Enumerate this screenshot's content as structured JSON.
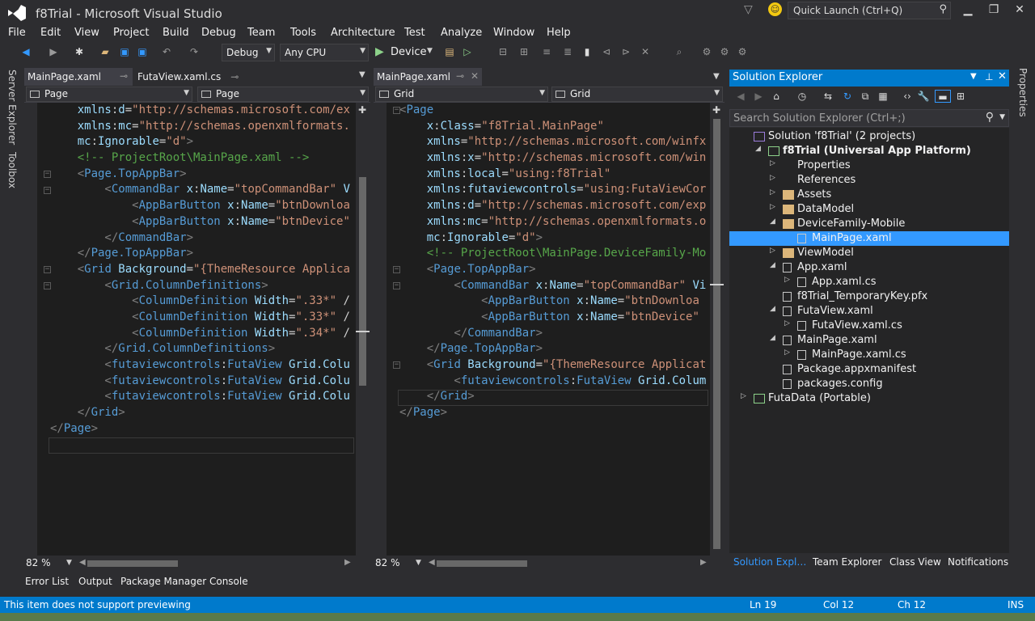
{
  "window": {
    "title": "f8Trial - Microsoft Visual Studio",
    "quick_launch_placeholder": "Quick Launch (Ctrl+Q)"
  },
  "menu": [
    "File",
    "Edit",
    "View",
    "Project",
    "Build",
    "Debug",
    "Team",
    "Tools",
    "Architecture",
    "Test",
    "Analyze",
    "Window",
    "Help"
  ],
  "toolbar": {
    "config": "Debug",
    "platform": "Any CPU",
    "run_target": "Device"
  },
  "side_tabs": [
    "Server Explorer",
    "Toolbox"
  ],
  "right_tabs": [
    "Properties"
  ],
  "left_editor": {
    "tabs": [
      "MainPage.xaml",
      "FutaView.xaml.cs"
    ],
    "nav_left": "Page",
    "nav_right": "Page",
    "zoom": "82 %",
    "lines": [
      [
        [
          "ns",
          "    xmlns"
        ],
        [
          "q",
          ":"
        ],
        [
          "at",
          "d"
        ],
        [
          "q",
          "="
        ],
        [
          "val",
          "\"http://schemas.microsoft.com/ex"
        ]
      ],
      [
        [
          "ns",
          "    xmlns"
        ],
        [
          "q",
          ":"
        ],
        [
          "at",
          "mc"
        ],
        [
          "q",
          "="
        ],
        [
          "val",
          "\"http://schemas.openxmlformats."
        ]
      ],
      [
        [
          "ns",
          "    mc"
        ],
        [
          "q",
          ":"
        ],
        [
          "at",
          "Ignorable"
        ],
        [
          "q",
          "="
        ],
        [
          "val",
          "\"d\""
        ],
        [
          "xb",
          ">"
        ]
      ],
      [
        [
          "cm",
          "    <!-- ProjectRoot\\MainPage.xaml -->"
        ]
      ],
      [
        [
          "xb",
          "    <"
        ],
        [
          "el",
          "Page.TopAppBar"
        ],
        [
          "xb",
          ">"
        ]
      ],
      [
        [
          "xb",
          "        <"
        ],
        [
          "el",
          "CommandBar"
        ],
        [
          "at",
          " x"
        ],
        [
          "q",
          ":"
        ],
        [
          "at",
          "Name"
        ],
        [
          "q",
          "="
        ],
        [
          "val",
          "\"topCommandBar\""
        ],
        [
          "at",
          " V"
        ]
      ],
      [
        [
          "xb",
          "            <"
        ],
        [
          "el",
          "AppBarButton"
        ],
        [
          "at",
          " x"
        ],
        [
          "q",
          ":"
        ],
        [
          "at",
          "Name"
        ],
        [
          "q",
          "="
        ],
        [
          "val",
          "\"btnDownloa"
        ]
      ],
      [
        [
          "xb",
          "            <"
        ],
        [
          "el",
          "AppBarButton"
        ],
        [
          "at",
          " x"
        ],
        [
          "q",
          ":"
        ],
        [
          "at",
          "Name"
        ],
        [
          "q",
          "="
        ],
        [
          "val",
          "\"btnDevice\""
        ]
      ],
      [
        [
          "xb",
          "        </"
        ],
        [
          "el",
          "CommandBar"
        ],
        [
          "xb",
          ">"
        ]
      ],
      [
        [
          "xb",
          "    </"
        ],
        [
          "el",
          "Page.TopAppBar"
        ],
        [
          "xb",
          ">"
        ]
      ],
      [
        [
          "xb",
          "    <"
        ],
        [
          "el",
          "Grid"
        ],
        [
          "at",
          " Background"
        ],
        [
          "q",
          "="
        ],
        [
          "val",
          "\"{ThemeResource Applica"
        ]
      ],
      [
        [
          "xb",
          "        <"
        ],
        [
          "el",
          "Grid.ColumnDefinitions"
        ],
        [
          "xb",
          ">"
        ]
      ],
      [
        [
          "xb",
          "            <"
        ],
        [
          "el",
          "ColumnDefinition"
        ],
        [
          "at",
          " Width"
        ],
        [
          "q",
          "="
        ],
        [
          "val",
          "\".33*\""
        ],
        [
          "q",
          " /"
        ]
      ],
      [
        [
          "xb",
          "            <"
        ],
        [
          "el",
          "ColumnDefinition"
        ],
        [
          "at",
          " Width"
        ],
        [
          "q",
          "="
        ],
        [
          "val",
          "\".33*\""
        ],
        [
          "q",
          " /"
        ]
      ],
      [
        [
          "xb",
          "            <"
        ],
        [
          "el",
          "ColumnDefinition"
        ],
        [
          "at",
          " Width"
        ],
        [
          "q",
          "="
        ],
        [
          "val",
          "\".34*\""
        ],
        [
          "q",
          " /"
        ]
      ],
      [
        [
          "xb",
          "        </"
        ],
        [
          "el",
          "Grid.ColumnDefinitions"
        ],
        [
          "xb",
          ">"
        ]
      ],
      [
        [
          "xb",
          "        <"
        ],
        [
          "el",
          "futaviewcontrols"
        ],
        [
          "q",
          ":"
        ],
        [
          "el",
          "FutaView"
        ],
        [
          "at",
          " Grid.Colu"
        ]
      ],
      [
        [
          "xb",
          "        <"
        ],
        [
          "el",
          "futaviewcontrols"
        ],
        [
          "q",
          ":"
        ],
        [
          "el",
          "FutaView"
        ],
        [
          "at",
          " Grid.Colu"
        ]
      ],
      [
        [
          "xb",
          "        <"
        ],
        [
          "el",
          "futaviewcontrols"
        ],
        [
          "q",
          ":"
        ],
        [
          "el",
          "FutaView"
        ],
        [
          "at",
          " Grid.Colu"
        ]
      ],
      [
        [
          "xb",
          "    </"
        ],
        [
          "el",
          "Grid"
        ],
        [
          "xb",
          ">"
        ]
      ],
      [
        [
          "xb",
          "</"
        ],
        [
          "el",
          "Page"
        ],
        [
          "xb",
          ">"
        ]
      ]
    ]
  },
  "right_editor": {
    "tabs": [
      "MainPage.xaml"
    ],
    "nav_left": "Grid",
    "nav_right": "Grid",
    "zoom": "82 %",
    "lines": [
      [
        [
          "xb",
          "<"
        ],
        [
          "el",
          "Page"
        ]
      ],
      [
        [
          "at",
          "    x"
        ],
        [
          "q",
          ":"
        ],
        [
          "at",
          "Class"
        ],
        [
          "q",
          "="
        ],
        [
          "val",
          "\"f8Trial.MainPage\""
        ]
      ],
      [
        [
          "ns",
          "    xmlns"
        ],
        [
          "q",
          "="
        ],
        [
          "val",
          "\"http://schemas.microsoft.com/winfx"
        ]
      ],
      [
        [
          "ns",
          "    xmlns"
        ],
        [
          "q",
          ":"
        ],
        [
          "at",
          "x"
        ],
        [
          "q",
          "="
        ],
        [
          "val",
          "\"http://schemas.microsoft.com/win"
        ]
      ],
      [
        [
          "ns",
          "    xmlns"
        ],
        [
          "q",
          ":"
        ],
        [
          "at",
          "local"
        ],
        [
          "q",
          "="
        ],
        [
          "val",
          "\"using:f8Trial\""
        ]
      ],
      [
        [
          "ns",
          "    xmlns"
        ],
        [
          "q",
          ":"
        ],
        [
          "at",
          "futaviewcontrols"
        ],
        [
          "q",
          "="
        ],
        [
          "val",
          "\"using:FutaViewCor"
        ]
      ],
      [
        [
          "ns",
          "    xmlns"
        ],
        [
          "q",
          ":"
        ],
        [
          "at",
          "d"
        ],
        [
          "q",
          "="
        ],
        [
          "val",
          "\"http://schemas.microsoft.com/exp"
        ]
      ],
      [
        [
          "ns",
          "    xmlns"
        ],
        [
          "q",
          ":"
        ],
        [
          "at",
          "mc"
        ],
        [
          "q",
          "="
        ],
        [
          "val",
          "\"http://schemas.openxmlformats.o"
        ]
      ],
      [
        [
          "ns",
          "    mc"
        ],
        [
          "q",
          ":"
        ],
        [
          "at",
          "Ignorable"
        ],
        [
          "q",
          "="
        ],
        [
          "val",
          "\"d\""
        ],
        [
          "xb",
          ">"
        ]
      ],
      [
        [
          "cm",
          "    <!-- ProjectRoot\\MainPage.DeviceFamily-Mo"
        ]
      ],
      [
        [
          "xb",
          "    <"
        ],
        [
          "el",
          "Page.TopAppBar"
        ],
        [
          "xb",
          ">"
        ]
      ],
      [
        [
          "xb",
          "        <"
        ],
        [
          "el",
          "CommandBar"
        ],
        [
          "at",
          " x"
        ],
        [
          "q",
          ":"
        ],
        [
          "at",
          "Name"
        ],
        [
          "q",
          "="
        ],
        [
          "val",
          "\"topCommandBar\""
        ],
        [
          "at",
          " Vi"
        ]
      ],
      [
        [
          "xb",
          "            <"
        ],
        [
          "el",
          "AppBarButton"
        ],
        [
          "at",
          " x"
        ],
        [
          "q",
          ":"
        ],
        [
          "at",
          "Name"
        ],
        [
          "q",
          "="
        ],
        [
          "val",
          "\"btnDownloa"
        ]
      ],
      [
        [
          "xb",
          "            <"
        ],
        [
          "el",
          "AppBarButton"
        ],
        [
          "at",
          " x"
        ],
        [
          "q",
          ":"
        ],
        [
          "at",
          "Name"
        ],
        [
          "q",
          "="
        ],
        [
          "val",
          "\"btnDevice\""
        ]
      ],
      [
        [
          "xb",
          "        </"
        ],
        [
          "el",
          "CommandBar"
        ],
        [
          "xb",
          ">"
        ]
      ],
      [
        [
          "xb",
          "    </"
        ],
        [
          "el",
          "Page.TopAppBar"
        ],
        [
          "xb",
          ">"
        ]
      ],
      [
        [
          "xb",
          "    <"
        ],
        [
          "el",
          "Grid"
        ],
        [
          "at",
          " Background"
        ],
        [
          "q",
          "="
        ],
        [
          "val",
          "\"{ThemeResource Applicat"
        ]
      ],
      [
        [
          "xb",
          "        <"
        ],
        [
          "el",
          "futaviewcontrols"
        ],
        [
          "q",
          ":"
        ],
        [
          "el",
          "FutaView"
        ],
        [
          "at",
          " Grid.Colum"
        ]
      ],
      [
        [
          "xb",
          "    </"
        ],
        [
          "el",
          "Grid"
        ],
        [
          "xb",
          ">"
        ]
      ],
      [
        [
          "xb",
          "</"
        ],
        [
          "el",
          "Page"
        ],
        [
          "xb",
          ">"
        ]
      ]
    ]
  },
  "solution_explorer": {
    "title": "Solution Explorer",
    "search_placeholder": "Search Solution Explorer (Ctrl+;)",
    "nodes": [
      {
        "label": "Solution 'f8Trial' (2 projects)",
        "indent": 0,
        "arrow": "",
        "icon": "solution-icon",
        "bold": false
      },
      {
        "label": "f8Trial (Universal App Platform)",
        "indent": 1,
        "arrow": "◢",
        "icon": "csharp-project-icon",
        "bold": true
      },
      {
        "label": "Properties",
        "indent": 2,
        "arrow": "▷",
        "icon": "wrench-icon",
        "bold": false
      },
      {
        "label": "References",
        "indent": 2,
        "arrow": "▷",
        "icon": "references-icon",
        "bold": false
      },
      {
        "label": "Assets",
        "indent": 2,
        "arrow": "▷",
        "icon": "folder-icon",
        "bold": false
      },
      {
        "label": "DataModel",
        "indent": 2,
        "arrow": "▷",
        "icon": "folder-icon",
        "bold": false
      },
      {
        "label": "DeviceFamily-Mobile",
        "indent": 2,
        "arrow": "◢",
        "icon": "folder-icon",
        "bold": false
      },
      {
        "label": "MainPage.xaml",
        "indent": 3,
        "arrow": "",
        "icon": "xaml-file-icon",
        "bold": false,
        "selected": true
      },
      {
        "label": "ViewModel",
        "indent": 2,
        "arrow": "▷",
        "icon": "folder-icon",
        "bold": false
      },
      {
        "label": "App.xaml",
        "indent": 2,
        "arrow": "◢",
        "icon": "xaml-file-icon",
        "bold": false
      },
      {
        "label": "App.xaml.cs",
        "indent": 3,
        "arrow": "▷",
        "icon": "cs-file-icon",
        "bold": false
      },
      {
        "label": "f8Trial_TemporaryKey.pfx",
        "indent": 2,
        "arrow": "",
        "icon": "key-file-icon",
        "bold": false
      },
      {
        "label": "FutaView.xaml",
        "indent": 2,
        "arrow": "◢",
        "icon": "xaml-file-icon",
        "bold": false
      },
      {
        "label": "FutaView.xaml.cs",
        "indent": 3,
        "arrow": "▷",
        "icon": "cs-file-icon",
        "bold": false
      },
      {
        "label": "MainPage.xaml",
        "indent": 2,
        "arrow": "◢",
        "icon": "xaml-file-icon",
        "bold": false
      },
      {
        "label": "MainPage.xaml.cs",
        "indent": 3,
        "arrow": "▷",
        "icon": "cs-file-icon",
        "bold": false
      },
      {
        "label": "Package.appxmanifest",
        "indent": 2,
        "arrow": "",
        "icon": "manifest-file-icon",
        "bold": false
      },
      {
        "label": "packages.config",
        "indent": 2,
        "arrow": "",
        "icon": "config-file-icon",
        "bold": false
      },
      {
        "label": "FutaData (Portable)",
        "indent": 0,
        "arrow": "▷",
        "icon": "csharp-project-icon",
        "bold": false
      }
    ],
    "bottom_tabs": [
      "Solution Expl…",
      "Team Explorer",
      "Class View",
      "Notifications"
    ]
  },
  "bottom_panel_tabs": [
    "Error List",
    "Output",
    "Package Manager Console"
  ],
  "status": {
    "message": "This item does not support previewing",
    "ln": "Ln 19",
    "col": "Col 12",
    "ch": "Ch 12",
    "mode": "INS"
  },
  "colors": {
    "accent": "#007acc",
    "selection": "#3399ff",
    "background": "#2d2d30",
    "editor": "#1e1e1e"
  }
}
